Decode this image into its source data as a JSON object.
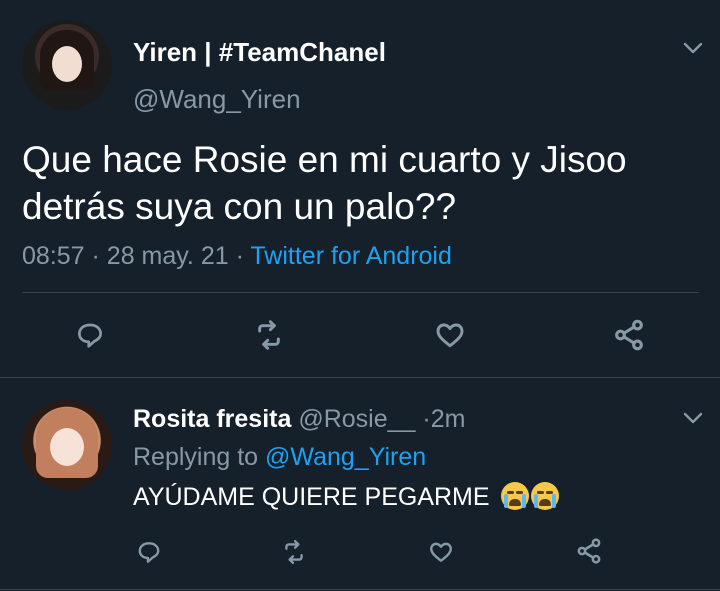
{
  "main_tweet": {
    "display_name": "Yiren | #TeamChanel",
    "handle": "@Wang_Yiren",
    "text_line1": "Que hace Rosie en mi cuarto y Jisoo",
    "text_line2": "detrás suya con un palo??",
    "time": "08:57",
    "date": "28 may. 21",
    "source": "Twitter for Android",
    "sep": "·"
  },
  "reply_tweet": {
    "display_name": "Rosita fresita",
    "handle": "@Rosie__",
    "age": "2m",
    "replying_label": "Replying to",
    "replying_to": "@Wang_Yiren",
    "text": "AYÚDAME QUIERE PEGARME",
    "emoji": [
      "loudly-crying-face",
      "loudly-crying-face"
    ]
  },
  "icons": {
    "reply": "reply-icon",
    "retweet": "retweet-icon",
    "like": "like-icon",
    "share": "share-icon",
    "menu": "chevron-down-icon"
  },
  "colors": {
    "background": "#15202b",
    "accent": "#1da1f2",
    "secondary_text": "#8899a6",
    "divider": "#38444d"
  }
}
